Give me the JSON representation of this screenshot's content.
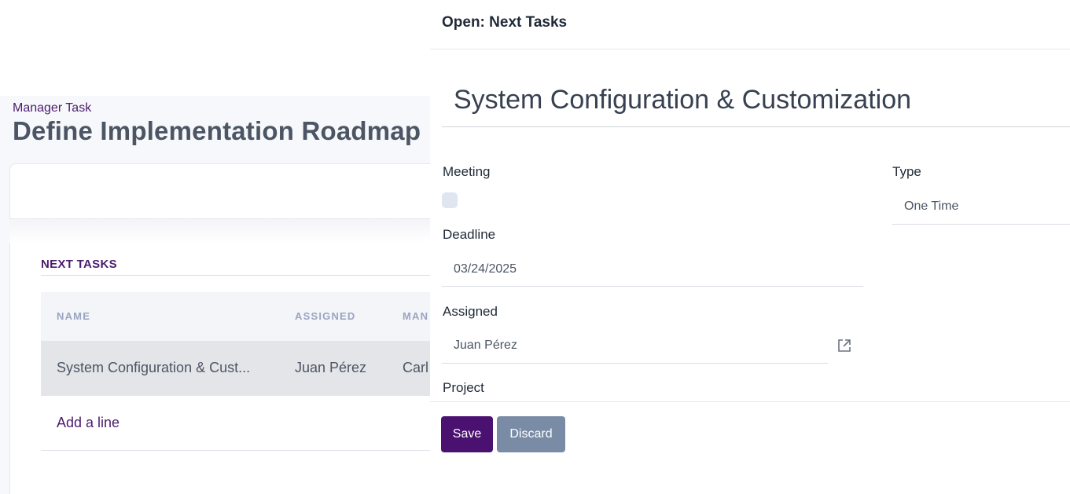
{
  "background": {
    "breadcrumb": "Manager Task",
    "record_title": "Define Implementation Roadmap",
    "section_title": "NEXT TASKS",
    "table": {
      "headers": [
        "NAME",
        "ASSIGNED",
        "MAN"
      ],
      "rows": [
        [
          "System Configuration & Cust...",
          "Juan Pérez",
          "Carl"
        ]
      ],
      "add_line_label": "Add a line"
    }
  },
  "dialog": {
    "title": "Open: Next Tasks",
    "name_value": "System Configuration & Customization",
    "fields": {
      "meeting_label": "Meeting",
      "meeting_checked": false,
      "type_label": "Type",
      "type_value": "One Time",
      "deadline_label": "Deadline",
      "deadline_value": "03/24/2025",
      "assigned_label": "Assigned",
      "assigned_value": "Juan Pérez",
      "project_label": "Project"
    },
    "buttons": {
      "save_label": "Save",
      "discard_label": "Discard"
    },
    "icons": {
      "external_link": "external-link-icon"
    },
    "colors": {
      "brand": "#4a1170",
      "discard": "#7a8ba6",
      "accent_text": "#4a1c6e"
    }
  }
}
